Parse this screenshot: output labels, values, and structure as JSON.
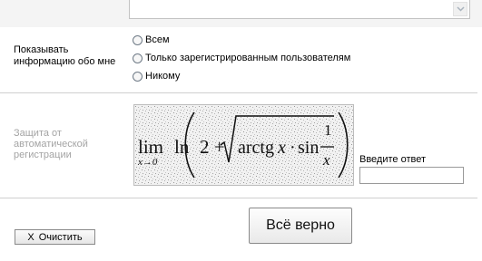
{
  "privacy": {
    "label": "Показывать информацию обо мне",
    "options": [
      {
        "label": "Всем",
        "selected": false
      },
      {
        "label": "Только зарегистрированным пользователям",
        "selected": false
      },
      {
        "label": "Никому",
        "selected": false
      }
    ]
  },
  "captcha": {
    "label": "Защита от автоматической регистрации",
    "answer_label": "Введите ответ",
    "answer_value": "",
    "formula": {
      "lim": "lim",
      "lim_sub": "x→0",
      "ln": "ln",
      "two_plus": "2 +",
      "arctg": "arctg",
      "x_var": "x",
      "dot": "·",
      "sin": "sin",
      "numerator": "1",
      "denominator": "x"
    }
  },
  "buttons": {
    "submit_label": "Всё верно",
    "clear_icon": "x-icon",
    "clear_x": "X",
    "clear_label": "Очистить"
  }
}
